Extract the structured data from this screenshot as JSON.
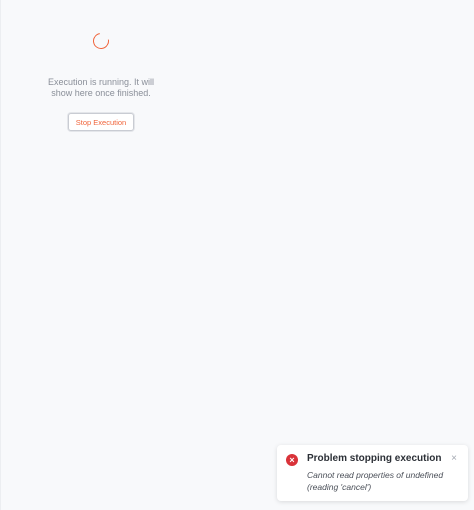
{
  "execution": {
    "status_text": "Execution is running. It will show here once finished.",
    "stop_button_label": "Stop Execution",
    "spinner_icon": "loading-spinner-icon"
  },
  "toast": {
    "title": "Problem stopping execution",
    "message": "Cannot read properties of undefined (reading 'cancel')",
    "error_icon": "error-icon",
    "close_icon": "close-icon",
    "error_glyph": "×",
    "close_glyph": "×"
  },
  "colors": {
    "accent": "#f0653c",
    "error": "#d93239",
    "background": "#f8f9fb"
  }
}
